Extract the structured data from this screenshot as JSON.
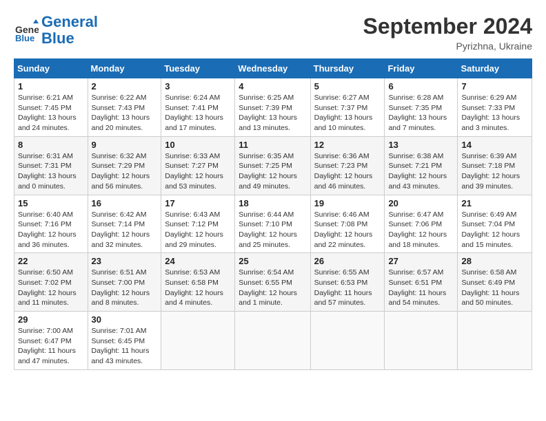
{
  "header": {
    "logo_line1": "General",
    "logo_line2": "Blue",
    "month_title": "September 2024",
    "subtitle": "Pyrizhna, Ukraine"
  },
  "weekdays": [
    "Sunday",
    "Monday",
    "Tuesday",
    "Wednesday",
    "Thursday",
    "Friday",
    "Saturday"
  ],
  "weeks": [
    [
      {
        "day": "1",
        "info": "Sunrise: 6:21 AM\nSunset: 7:45 PM\nDaylight: 13 hours and 24 minutes."
      },
      {
        "day": "2",
        "info": "Sunrise: 6:22 AM\nSunset: 7:43 PM\nDaylight: 13 hours and 20 minutes."
      },
      {
        "day": "3",
        "info": "Sunrise: 6:24 AM\nSunset: 7:41 PM\nDaylight: 13 hours and 17 minutes."
      },
      {
        "day": "4",
        "info": "Sunrise: 6:25 AM\nSunset: 7:39 PM\nDaylight: 13 hours and 13 minutes."
      },
      {
        "day": "5",
        "info": "Sunrise: 6:27 AM\nSunset: 7:37 PM\nDaylight: 13 hours and 10 minutes."
      },
      {
        "day": "6",
        "info": "Sunrise: 6:28 AM\nSunset: 7:35 PM\nDaylight: 13 hours and 7 minutes."
      },
      {
        "day": "7",
        "info": "Sunrise: 6:29 AM\nSunset: 7:33 PM\nDaylight: 13 hours and 3 minutes."
      }
    ],
    [
      {
        "day": "8",
        "info": "Sunrise: 6:31 AM\nSunset: 7:31 PM\nDaylight: 13 hours and 0 minutes."
      },
      {
        "day": "9",
        "info": "Sunrise: 6:32 AM\nSunset: 7:29 PM\nDaylight: 12 hours and 56 minutes."
      },
      {
        "day": "10",
        "info": "Sunrise: 6:33 AM\nSunset: 7:27 PM\nDaylight: 12 hours and 53 minutes."
      },
      {
        "day": "11",
        "info": "Sunrise: 6:35 AM\nSunset: 7:25 PM\nDaylight: 12 hours and 49 minutes."
      },
      {
        "day": "12",
        "info": "Sunrise: 6:36 AM\nSunset: 7:23 PM\nDaylight: 12 hours and 46 minutes."
      },
      {
        "day": "13",
        "info": "Sunrise: 6:38 AM\nSunset: 7:21 PM\nDaylight: 12 hours and 43 minutes."
      },
      {
        "day": "14",
        "info": "Sunrise: 6:39 AM\nSunset: 7:18 PM\nDaylight: 12 hours and 39 minutes."
      }
    ],
    [
      {
        "day": "15",
        "info": "Sunrise: 6:40 AM\nSunset: 7:16 PM\nDaylight: 12 hours and 36 minutes."
      },
      {
        "day": "16",
        "info": "Sunrise: 6:42 AM\nSunset: 7:14 PM\nDaylight: 12 hours and 32 minutes."
      },
      {
        "day": "17",
        "info": "Sunrise: 6:43 AM\nSunset: 7:12 PM\nDaylight: 12 hours and 29 minutes."
      },
      {
        "day": "18",
        "info": "Sunrise: 6:44 AM\nSunset: 7:10 PM\nDaylight: 12 hours and 25 minutes."
      },
      {
        "day": "19",
        "info": "Sunrise: 6:46 AM\nSunset: 7:08 PM\nDaylight: 12 hours and 22 minutes."
      },
      {
        "day": "20",
        "info": "Sunrise: 6:47 AM\nSunset: 7:06 PM\nDaylight: 12 hours and 18 minutes."
      },
      {
        "day": "21",
        "info": "Sunrise: 6:49 AM\nSunset: 7:04 PM\nDaylight: 12 hours and 15 minutes."
      }
    ],
    [
      {
        "day": "22",
        "info": "Sunrise: 6:50 AM\nSunset: 7:02 PM\nDaylight: 12 hours and 11 minutes."
      },
      {
        "day": "23",
        "info": "Sunrise: 6:51 AM\nSunset: 7:00 PM\nDaylight: 12 hours and 8 minutes."
      },
      {
        "day": "24",
        "info": "Sunrise: 6:53 AM\nSunset: 6:58 PM\nDaylight: 12 hours and 4 minutes."
      },
      {
        "day": "25",
        "info": "Sunrise: 6:54 AM\nSunset: 6:55 PM\nDaylight: 12 hours and 1 minute."
      },
      {
        "day": "26",
        "info": "Sunrise: 6:55 AM\nSunset: 6:53 PM\nDaylight: 11 hours and 57 minutes."
      },
      {
        "day": "27",
        "info": "Sunrise: 6:57 AM\nSunset: 6:51 PM\nDaylight: 11 hours and 54 minutes."
      },
      {
        "day": "28",
        "info": "Sunrise: 6:58 AM\nSunset: 6:49 PM\nDaylight: 11 hours and 50 minutes."
      }
    ],
    [
      {
        "day": "29",
        "info": "Sunrise: 7:00 AM\nSunset: 6:47 PM\nDaylight: 11 hours and 47 minutes."
      },
      {
        "day": "30",
        "info": "Sunrise: 7:01 AM\nSunset: 6:45 PM\nDaylight: 11 hours and 43 minutes."
      },
      {
        "day": "",
        "info": ""
      },
      {
        "day": "",
        "info": ""
      },
      {
        "day": "",
        "info": ""
      },
      {
        "day": "",
        "info": ""
      },
      {
        "day": "",
        "info": ""
      }
    ]
  ]
}
